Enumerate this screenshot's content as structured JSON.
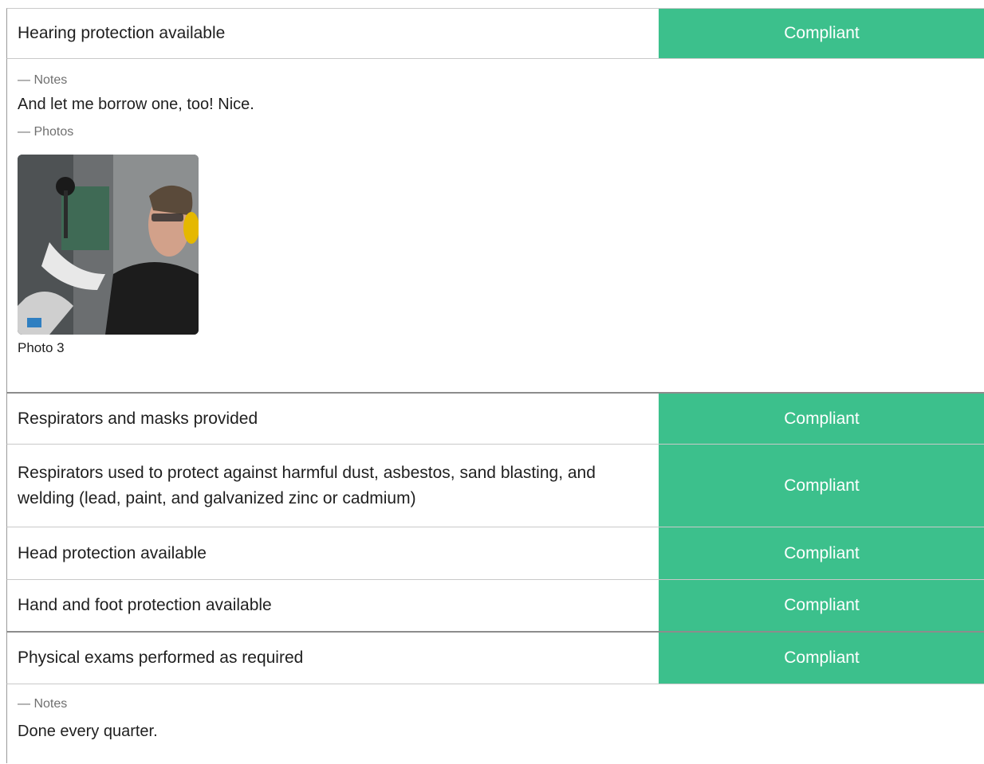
{
  "items": [
    {
      "question": "Hearing protection available",
      "status": "Compliant",
      "notes_label": "— Notes",
      "notes": "And let me borrow one, too! Nice.",
      "photos_label": "— Photos",
      "photo_caption": "Photo 3"
    },
    {
      "question": "Respirators and masks provided",
      "status": "Compliant"
    },
    {
      "question": "Respirators used to protect against harmful dust, asbestos, sand blasting, and welding (lead, paint, and galvanized zinc or cadmium)",
      "status": "Compliant"
    },
    {
      "question": "Head protection available",
      "status": "Compliant"
    },
    {
      "question": "Hand and foot protection available",
      "status": "Compliant"
    },
    {
      "question": "Physical exams performed as required",
      "status": "Compliant",
      "notes_label": "— Notes",
      "notes": "Done every quarter."
    }
  ],
  "colors": {
    "compliant": "#3cc08c"
  }
}
